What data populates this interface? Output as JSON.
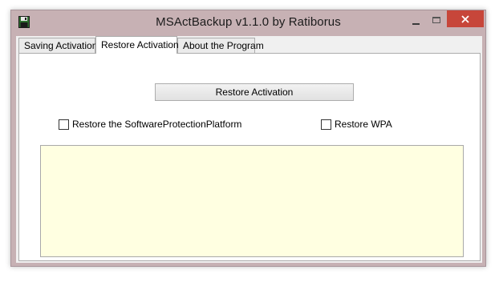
{
  "window": {
    "title": "MSActBackup v1.1.0 by Ratiborus",
    "icon": "floppy-disk-icon",
    "controls": {
      "minimize": "minimize-icon",
      "maximize": "maximize-icon",
      "close": "close-icon"
    },
    "accent_close": "#c7463a",
    "frame_color": "#c7b1b4"
  },
  "tabs": [
    {
      "label": "Saving Activation",
      "active": false
    },
    {
      "label": "Restore Activation",
      "active": true
    },
    {
      "label": "About the Program",
      "active": false
    }
  ],
  "restore_tab": {
    "button_label": "Restore Activation",
    "checkboxes": [
      {
        "label": "Restore the SoftwareProtectionPlatform",
        "checked": false
      },
      {
        "label": "Restore WPA",
        "checked": false
      }
    ],
    "log_text": "",
    "log_background": "#ffffe1"
  }
}
